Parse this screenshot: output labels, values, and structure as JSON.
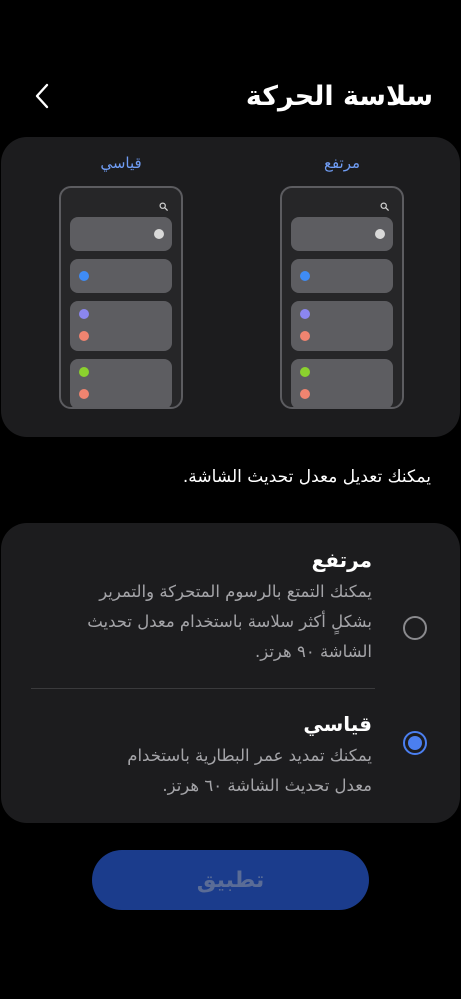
{
  "header": {
    "title": "سلاسة الحركة",
    "back_icon": "chevron-left-icon"
  },
  "preview": {
    "high_label": "مرتفع",
    "standard_label": "قياسي"
  },
  "description": "يمكنك تعديل معدل تحديث الشاشة.",
  "options": [
    {
      "title": "مرتفع",
      "description": "يمكنك التمتع بالرسوم المتحركة والتمرير بشكلٍ أكثر سلاسة باستخدام معدل تحديث الشاشة ٩٠ هرتز.",
      "selected": false
    },
    {
      "title": "قياسي",
      "description": "يمكنك تمديد عمر البطارية باستخدام معدل تحديث الشاشة ٦٠ هرتز.",
      "selected": true
    }
  ],
  "apply_button": {
    "label": "تطبيق",
    "enabled": false
  },
  "colors": {
    "accent": "#4b7ff0",
    "preview_label": "#6f9cf3",
    "card_background": "#1c1c1e",
    "apply_button_background": "#1b3c8c",
    "dot_white": "#d9d9d9",
    "dot_blue": "#3f8cf5",
    "dot_purple": "#8b86ef",
    "dot_coral": "#ef8470",
    "dot_green": "#8bd12e"
  }
}
